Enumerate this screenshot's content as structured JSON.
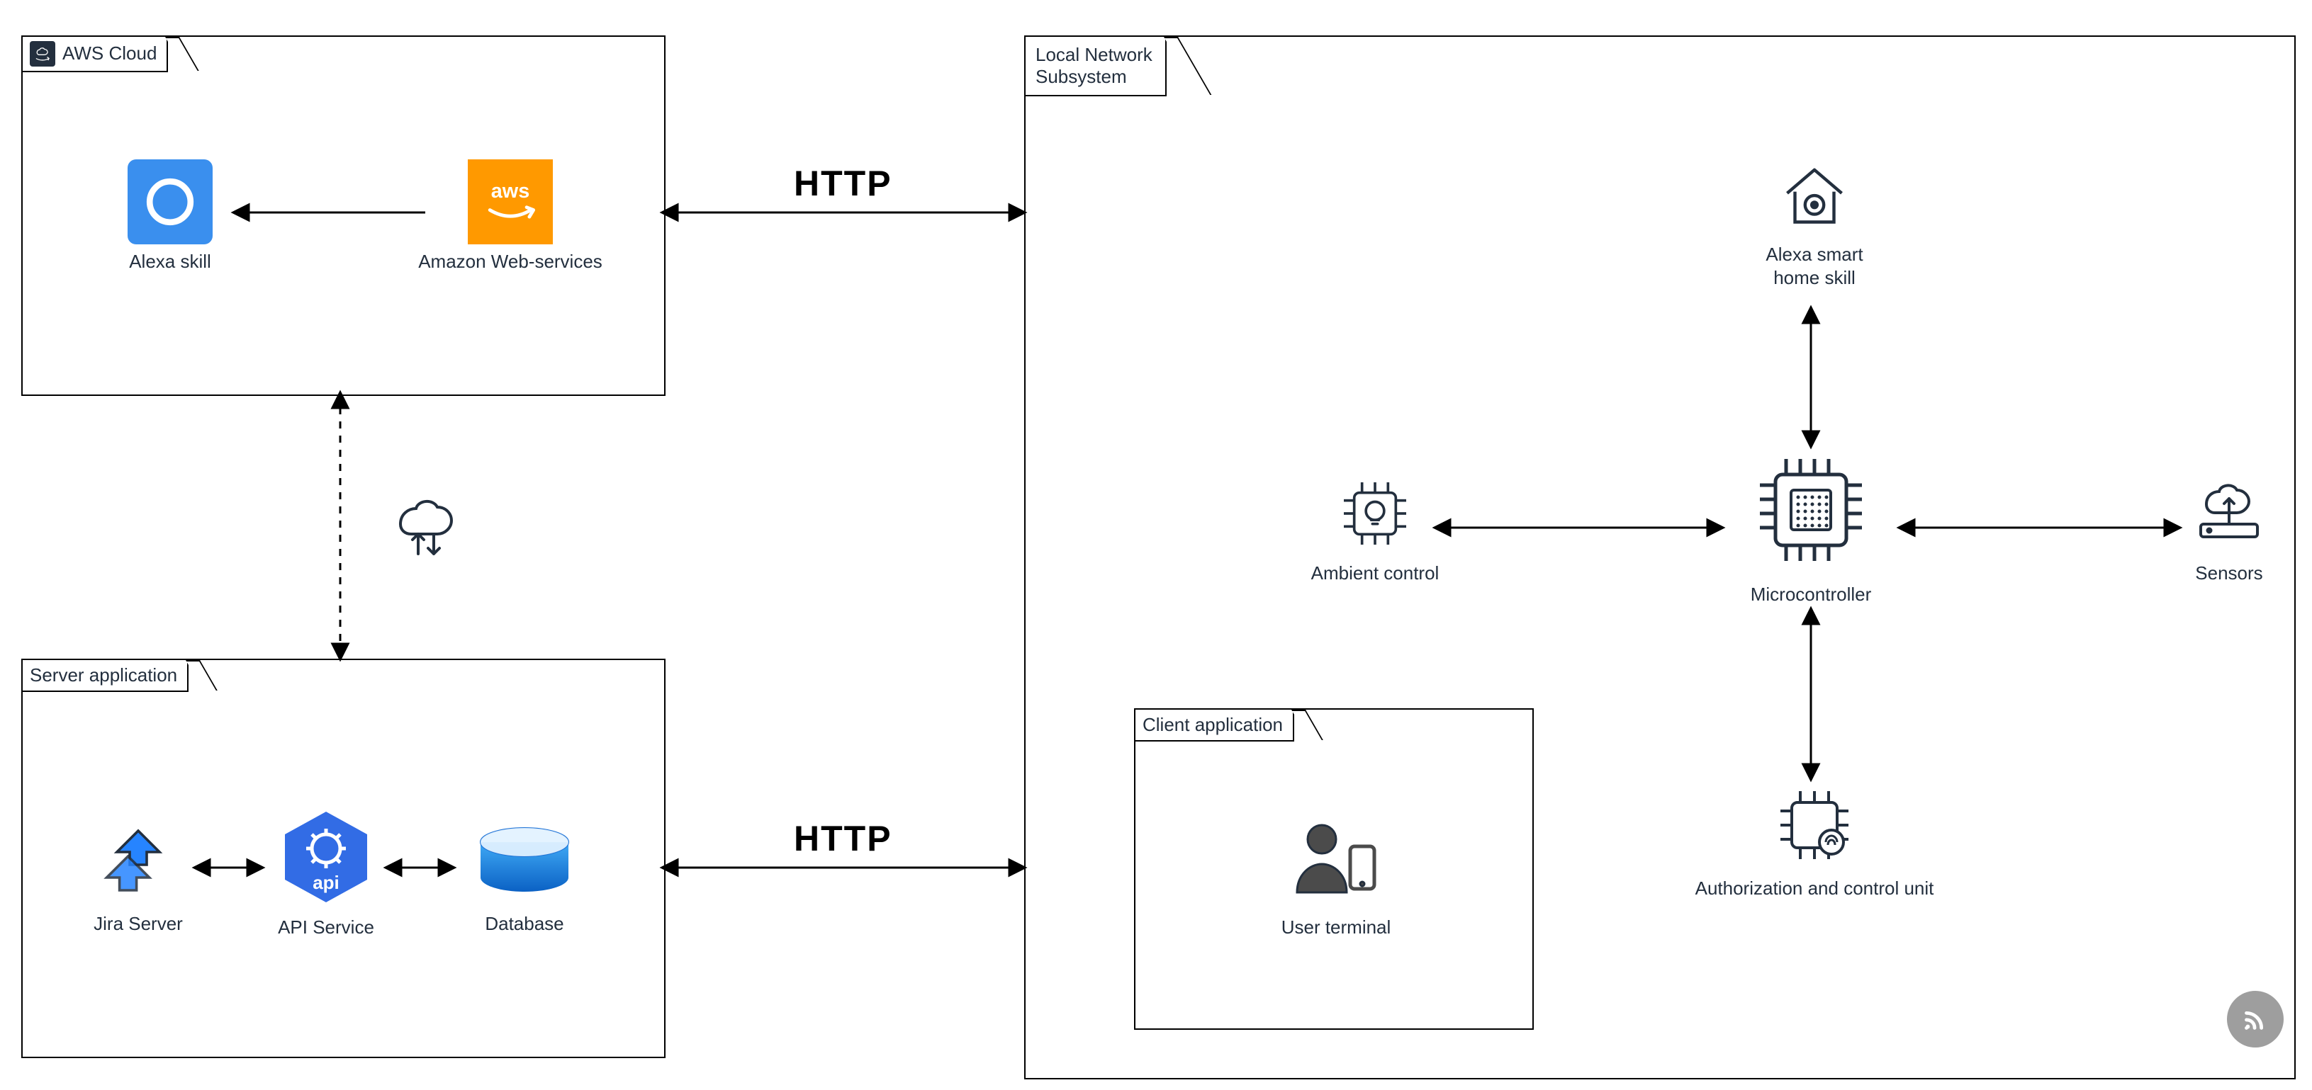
{
  "groups": {
    "aws_cloud": {
      "label": "AWS Cloud"
    },
    "server_app": {
      "label": "Server application"
    },
    "local_net": {
      "label": "Local Network\nSubsystem"
    },
    "client_app": {
      "label": "Client application"
    }
  },
  "nodes": {
    "alexa_skill": {
      "label": "Alexa skill"
    },
    "aws": {
      "label": "Amazon Web-services",
      "logo_text": "aws"
    },
    "jira": {
      "label": "Jira Server"
    },
    "api_service": {
      "label": "API Service",
      "badge_text": "api"
    },
    "database": {
      "label": "Database"
    },
    "alexa_home": {
      "label": "Alexa smart\nhome skill"
    },
    "ambient": {
      "label": "Ambient control"
    },
    "micro": {
      "label": "Microcontroller"
    },
    "sensors": {
      "label": "Sensors"
    },
    "auth_unit": {
      "label": "Authorization and control unit"
    },
    "user_terminal": {
      "label": "User terminal"
    }
  },
  "connectors": {
    "http": "HTTP"
  }
}
